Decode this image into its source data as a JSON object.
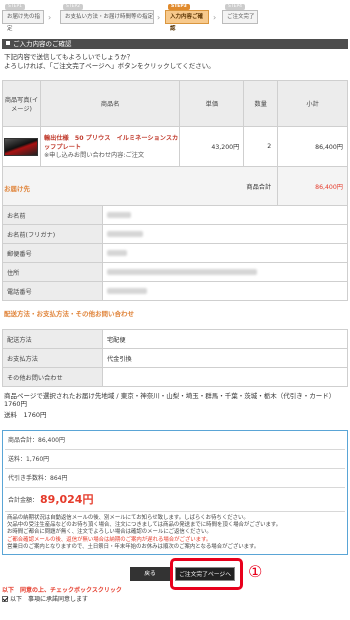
{
  "steps": [
    {
      "num": "STEP1",
      "label": "お届け先の指定"
    },
    {
      "num": "STEP2",
      "label": "お支払い方法・お届け時間等の指定"
    },
    {
      "num": "STEP3",
      "label": "入力内容ご確認"
    },
    {
      "num": "STEP4",
      "label": "ご注文完了"
    }
  ],
  "confirm": {
    "title": "ご入力内容のご確認",
    "intro1": "下記内容で送信してもよろしいでしょうか？",
    "intro2": "よろしければ、「ご注文完了ページへ」ボタンをクリックしてください。"
  },
  "cart": {
    "headers": {
      "photo": "商品写真(イメージ)",
      "name": "商品名",
      "price": "単価",
      "qty": "数量",
      "subtotal": "小計"
    },
    "item": {
      "name": "輸出仕様　50 プリウス　イルミネーションスカッフプレート",
      "note": "※申し込みお問い合わせ内容:ご注文",
      "price": "43,200円",
      "qty": "2",
      "subtotal": "86,400円"
    },
    "total_label": "商品合計",
    "total_value": "86,400円"
  },
  "delivery": {
    "title": "お届け先",
    "rows": [
      {
        "label": "お名前"
      },
      {
        "label": "お名前(フリガナ)"
      },
      {
        "label": "郵便番号"
      },
      {
        "label": "住所"
      },
      {
        "label": "電話番号"
      }
    ]
  },
  "shipping": {
    "title": "配送方法・お支払方法・その他お問い合わせ",
    "rows": [
      {
        "label": "配送方法",
        "value": "宅配便"
      },
      {
        "label": "お支払方法",
        "value": "代金引換"
      },
      {
        "label": "その他お問い合わせ",
        "value": ""
      }
    ],
    "note1": "商品ページで選択されたお届け先地域 / 東京・神奈川・山梨・埼玉・群馬・千葉・茨城・栃木（代引き・カード）1760円",
    "note2": "送料　1760円"
  },
  "summary": {
    "subtotal": "商品合計：86,400円",
    "shipping": "送料：1,760円",
    "cod_fee": "代引き手数料：864円",
    "total_label": "合計金額：",
    "total_value": "89,024円",
    "notes": [
      "商品の納期状況は自動返信メールの後、別メールにてお知らせ致します。しばらくお待ちください。",
      "欠品中の受注生産品などのお待ち頂く場合、注文につきましては商品の発送までに時間を頂く場合がございます。",
      "お時間ご都合に問題が無く、注文でよろしい場合は確認のメールにご返信ください。",
      "ご都合確認メールの後、返信が無い場合は納期のご案内が遅れる場合がございます。",
      "営業日のご案内となりますので、土日祭日・年末年始のお休みは順次のご案内となる場合がございます。"
    ]
  },
  "buttons": {
    "back": "戻る",
    "order": "ご注文完了ページへ"
  },
  "marker": "①",
  "agree": {
    "warning": "以下　同意の上、チェックボックスクリック",
    "label": "以下　事項に承諾同意します"
  },
  "colors": {
    "accent": "#e53a2a",
    "highlight": "#e8001c",
    "section": "#e0843a",
    "border": "#5aa5d6"
  }
}
